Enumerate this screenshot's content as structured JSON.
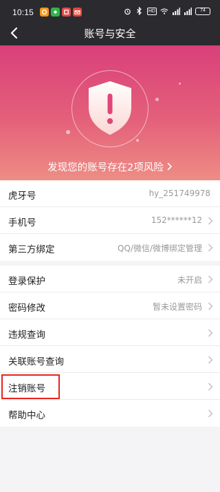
{
  "status_bar": {
    "time": "10:15",
    "battery": "74"
  },
  "nav": {
    "title": "账号与安全"
  },
  "banner": {
    "risk_text": "发现您的账号存在2项风险"
  },
  "group1": [
    {
      "label": "虎牙号",
      "value": "hy_251749978"
    },
    {
      "label": "手机号",
      "value": "152******12"
    },
    {
      "label": "第三方绑定",
      "value": "QQ/微信/微博绑定管理"
    }
  ],
  "group2": [
    {
      "label": "登录保护",
      "value": "未开启"
    },
    {
      "label": "密码修改",
      "value": "暂未设置密码"
    },
    {
      "label": "违规查询",
      "value": ""
    },
    {
      "label": "关联账号查询",
      "value": ""
    },
    {
      "label": "注销账号",
      "value": ""
    },
    {
      "label": "帮助中心",
      "value": ""
    }
  ],
  "colors": {
    "accent_highlight": "#e8231d",
    "banner_top": "#d9407a",
    "banner_bottom": "#ee8d84"
  }
}
